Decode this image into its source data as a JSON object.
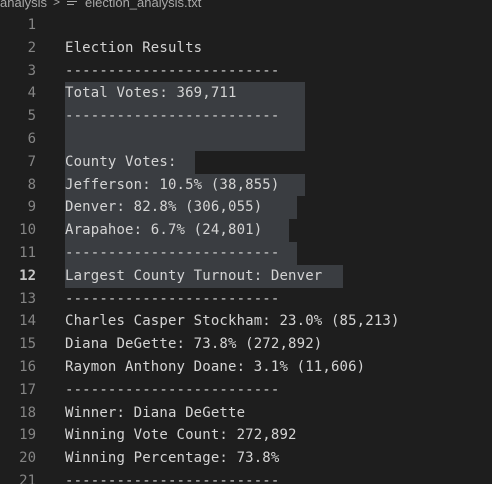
{
  "breadcrumb": {
    "folder": "analysis",
    "separator": ">",
    "file": "election_analysis.txt"
  },
  "editor": {
    "active_line": 12,
    "lines": [
      {
        "num": "1",
        "text": ""
      },
      {
        "num": "2",
        "text": "Election Results"
      },
      {
        "num": "3",
        "text": "-------------------------"
      },
      {
        "num": "4",
        "text": "Total Votes: 369,711"
      },
      {
        "num": "5",
        "text": "-------------------------"
      },
      {
        "num": "6",
        "text": ""
      },
      {
        "num": "7",
        "text": "County Votes:"
      },
      {
        "num": "8",
        "text": "Jefferson: 10.5% (38,855)"
      },
      {
        "num": "9",
        "text": "Denver: 82.8% (306,055)"
      },
      {
        "num": "10",
        "text": "Arapahoe: 6.7% (24,801)"
      },
      {
        "num": "11",
        "text": "-------------------------"
      },
      {
        "num": "12",
        "text": "Largest County Turnout: Denver"
      },
      {
        "num": "13",
        "text": "-------------------------"
      },
      {
        "num": "14",
        "text": "Charles Casper Stockham: 23.0% (85,213)"
      },
      {
        "num": "15",
        "text": "Diana DeGette: 73.8% (272,892)"
      },
      {
        "num": "16",
        "text": "Raymon Anthony Doane: 3.1% (11,606)"
      },
      {
        "num": "17",
        "text": "-------------------------"
      },
      {
        "num": "18",
        "text": "Winner: Diana DeGette"
      },
      {
        "num": "19",
        "text": "Winning Vote Count: 272,892"
      },
      {
        "num": "20",
        "text": "Winning Percentage: 73.8%"
      },
      {
        "num": "21",
        "text": "-------------------------"
      }
    ]
  }
}
